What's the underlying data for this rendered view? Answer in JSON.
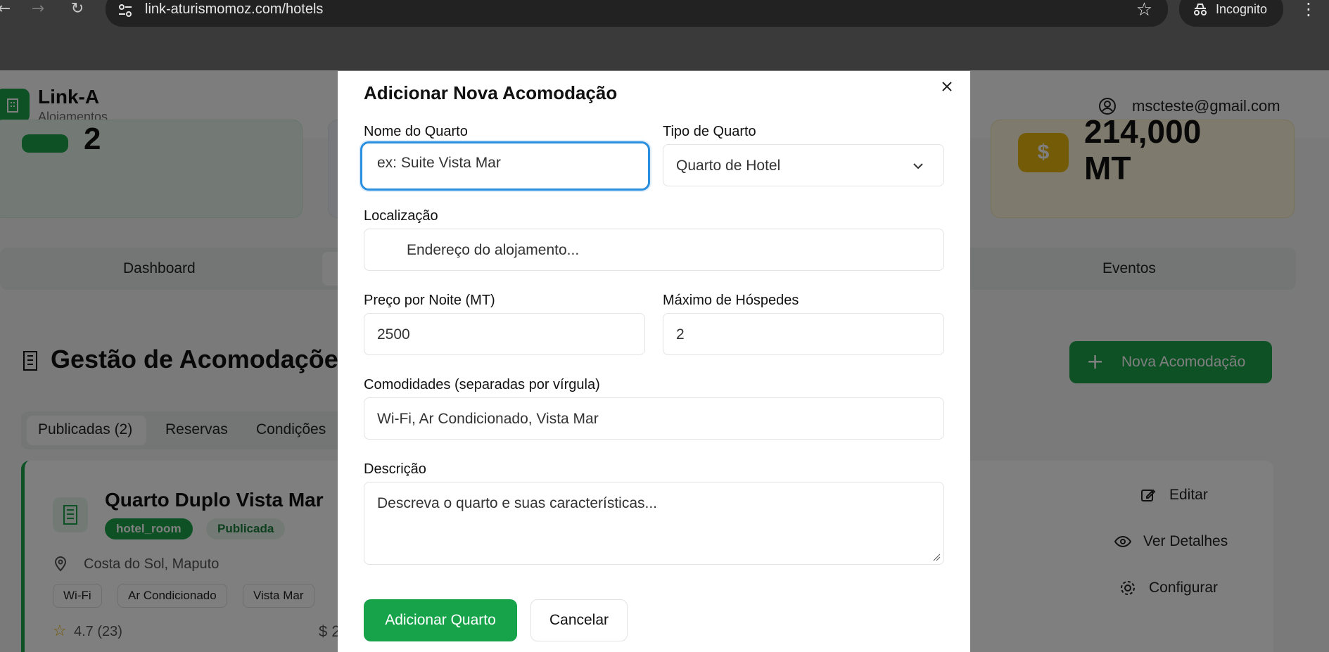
{
  "browser": {
    "url": "link-aturismomoz.com/hotels",
    "incognito_label": "Incognito"
  },
  "app": {
    "brand": "Link-A",
    "brand_sub": "Alojamentos",
    "user_email": "mscteste@gmail.com",
    "stats": {
      "green_value": "2",
      "yellow_value": "214,000\nMT",
      "yellow_icon": "$"
    },
    "tabs": [
      "Dashboard",
      "Eventos"
    ],
    "section_title": "Gestão de Acomodações",
    "new_button": "Nova Acomodação",
    "sub_tabs": [
      "Publicadas (2)",
      "Reservas",
      "Condições"
    ],
    "listing": {
      "title": "Quarto Duplo Vista Mar",
      "badges": [
        "hotel_room",
        "Publicada"
      ],
      "location": "Costa do Sol, Maputo",
      "amenities": [
        "Wi-Fi",
        "Ar Condicionado",
        "Vista Mar"
      ],
      "rating": "4.7 (23)",
      "price_icon": "$ 2",
      "actions": [
        "Editar",
        "Ver Detalhes",
        "Configurar"
      ]
    }
  },
  "modal": {
    "title": "Adicionar Nova Acomodação",
    "fields": {
      "room_name": {
        "label": "Nome do Quarto",
        "placeholder": "ex: Suite Vista Mar"
      },
      "room_type": {
        "label": "Tipo de Quarto",
        "value": "Quarto de Hotel"
      },
      "location": {
        "label": "Localização",
        "placeholder": "Endereço do alojamento..."
      },
      "price": {
        "label": "Preço por Noite (MT)",
        "value": "2500"
      },
      "guests": {
        "label": "Máximo de Hóspedes",
        "value": "2"
      },
      "amenities": {
        "label": "Comodidades (separadas por vírgula)",
        "value": "Wi-Fi, Ar Condicionado, Vista Mar"
      },
      "description": {
        "label": "Descrição",
        "placeholder": "Descreva o quarto e suas características..."
      }
    },
    "add_button": "Adicionar Quarto",
    "cancel_button": "Cancelar"
  },
  "colors": {
    "accent_green": "#1aa34a",
    "focus_blue": "#2b8fe0",
    "overlay": "rgba(0,0,0,0.5)"
  }
}
